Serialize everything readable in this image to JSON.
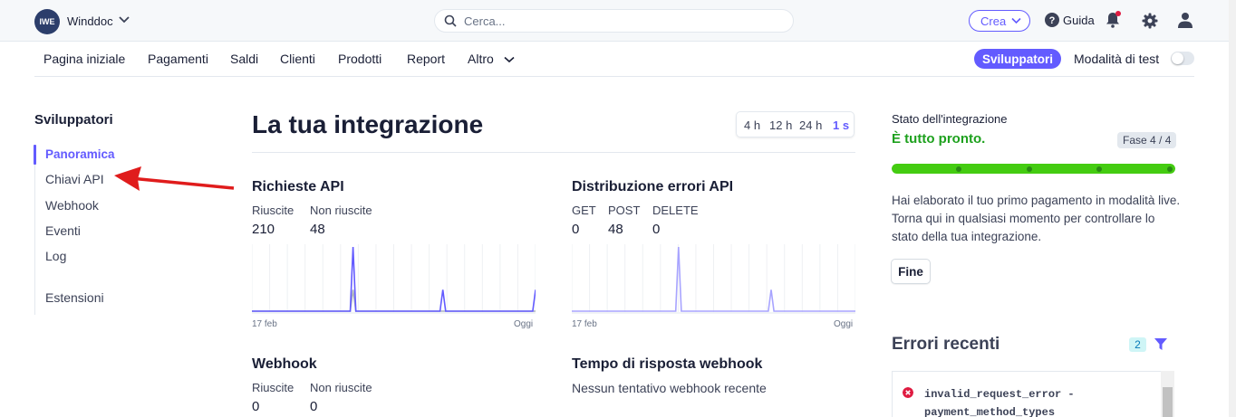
{
  "topbar": {
    "logo_text": "IWE",
    "account_name": "Winddoc",
    "search_placeholder": "Cerca...",
    "create_label": "Crea",
    "help_label": "Guida"
  },
  "nav": {
    "items": [
      "Pagina iniziale",
      "Pagamenti",
      "Saldi",
      "Clienti",
      "Prodotti",
      "Report",
      "Altro"
    ],
    "developers_label": "Sviluppatori",
    "test_mode_label": "Modalità di test",
    "test_mode_on": false
  },
  "sidebar": {
    "title": "Sviluppatori",
    "items": [
      "Panoramica",
      "Chiavi API",
      "Webhook",
      "Eventi",
      "Log",
      "Estensioni"
    ],
    "active": "Panoramica"
  },
  "main": {
    "title": "La tua integrazione",
    "ranges": [
      "4 h",
      "12 h",
      "24 h",
      "1 s"
    ],
    "selected_range": "1 s",
    "api_requests": {
      "title": "Richieste API",
      "stats": [
        {
          "label": "Riuscite",
          "value": "210"
        },
        {
          "label": "Non riuscite",
          "value": "48"
        }
      ],
      "x_start": "17 feb",
      "x_end": "Oggi"
    },
    "error_distribution": {
      "title": "Distribuzione errori API",
      "stats": [
        {
          "label": "GET",
          "value": "0"
        },
        {
          "label": "POST",
          "value": "48"
        },
        {
          "label": "DELETE",
          "value": "0"
        }
      ],
      "x_start": "17 feb",
      "x_end": "Oggi"
    },
    "webhook": {
      "title": "Webhook",
      "stats": [
        {
          "label": "Riuscite",
          "value": "0"
        },
        {
          "label": "Non riuscite",
          "value": "0"
        }
      ]
    },
    "webhook_response": {
      "title": "Tempo di risposta webhook",
      "empty_text": "Nessun tentativo webhook recente"
    }
  },
  "chart_data": [
    {
      "type": "line",
      "x_start": "17 feb",
      "x_end": "Oggi",
      "series": [
        {
          "values": [
            0,
            0,
            0,
            0,
            0,
            0,
            0,
            0,
            0,
            0,
            0,
            0,
            0,
            0,
            0,
            0,
            0,
            0,
            0,
            0,
            0,
            0,
            0,
            0,
            0,
            0,
            0,
            0,
            0,
            0,
            0,
            0,
            0,
            0,
            0,
            0,
            1,
            0,
            0,
            0,
            0,
            0,
            0,
            0,
            0,
            0,
            0,
            0,
            0,
            0,
            0,
            0,
            0,
            0,
            0,
            0,
            0,
            0,
            0,
            0,
            0,
            0,
            0,
            0,
            0,
            0,
            0,
            0,
            0,
            0,
            0,
            0,
            0,
            0,
            0,
            0,
            0,
            0,
            0,
            0,
            0,
            0,
            0,
            0,
            0,
            0,
            0,
            0,
            0,
            0,
            0,
            0,
            0,
            0,
            0,
            0,
            0,
            0,
            0,
            0,
            0,
            0
          ],
          "color": "#aab2bd"
        },
        {
          "values": [
            0,
            0,
            0,
            0,
            0,
            0,
            0,
            0,
            0,
            0,
            0,
            0,
            0,
            0,
            0,
            0,
            0,
            0,
            0,
            0,
            0,
            0,
            0,
            0,
            0,
            0,
            0,
            0,
            0,
            0,
            0,
            0,
            0,
            0,
            0,
            0,
            3,
            0,
            0,
            0,
            0,
            0,
            0,
            0,
            0,
            0,
            0,
            0,
            0,
            0,
            0,
            0,
            0,
            0,
            0,
            0,
            0,
            0,
            0,
            0,
            0,
            0,
            0,
            0,
            0,
            0,
            0,
            0,
            1,
            0,
            0,
            0,
            0,
            0,
            0,
            0,
            0,
            0,
            0,
            0,
            0,
            0,
            0,
            0,
            0,
            0,
            0,
            0,
            0,
            0,
            0,
            0,
            0,
            0,
            0,
            0,
            0,
            0,
            0,
            0,
            0,
            1
          ],
          "color": "#635bff"
        }
      ]
    },
    {
      "type": "line",
      "x_start": "17 feb",
      "x_end": "Oggi",
      "series": [
        {
          "values": [
            0,
            0,
            0,
            0,
            0,
            0,
            0,
            0,
            0,
            0,
            0,
            0,
            0,
            0,
            0,
            0,
            0,
            0,
            0,
            0,
            0,
            0,
            0,
            0,
            0,
            0,
            0,
            0,
            0,
            0,
            0,
            0,
            0,
            0,
            0,
            0,
            0,
            0,
            3,
            0,
            0,
            0,
            0,
            0,
            0,
            0,
            0,
            0,
            0,
            0,
            0,
            0,
            0,
            0,
            0,
            0,
            0,
            0,
            0,
            0,
            0,
            0,
            0,
            0,
            0,
            0,
            0,
            0,
            0,
            0,
            0,
            1,
            0,
            0,
            0,
            0,
            0,
            0,
            0,
            0,
            0,
            0,
            0,
            0,
            0,
            0,
            0,
            0,
            0,
            0,
            0,
            0,
            0,
            0,
            0,
            0,
            0,
            0,
            0,
            0,
            0,
            0
          ],
          "color": "#a8a4ff"
        }
      ]
    }
  ],
  "status": {
    "label": "Stato dell'integrazione",
    "headline": "È tutto pronto.",
    "phase": "Fase 4 / 4",
    "progress": 1.0,
    "description": "Hai elaborato il tuo primo pagamento in modalità live. Torna qui in qualsiasi momento per controllare lo stato della tua integrazione.",
    "done_label": "Fine"
  },
  "errors": {
    "title": "Errori recenti",
    "count": "2",
    "first_error_line1": "invalid_request_error -",
    "first_error_line2": "payment_method_types"
  }
}
